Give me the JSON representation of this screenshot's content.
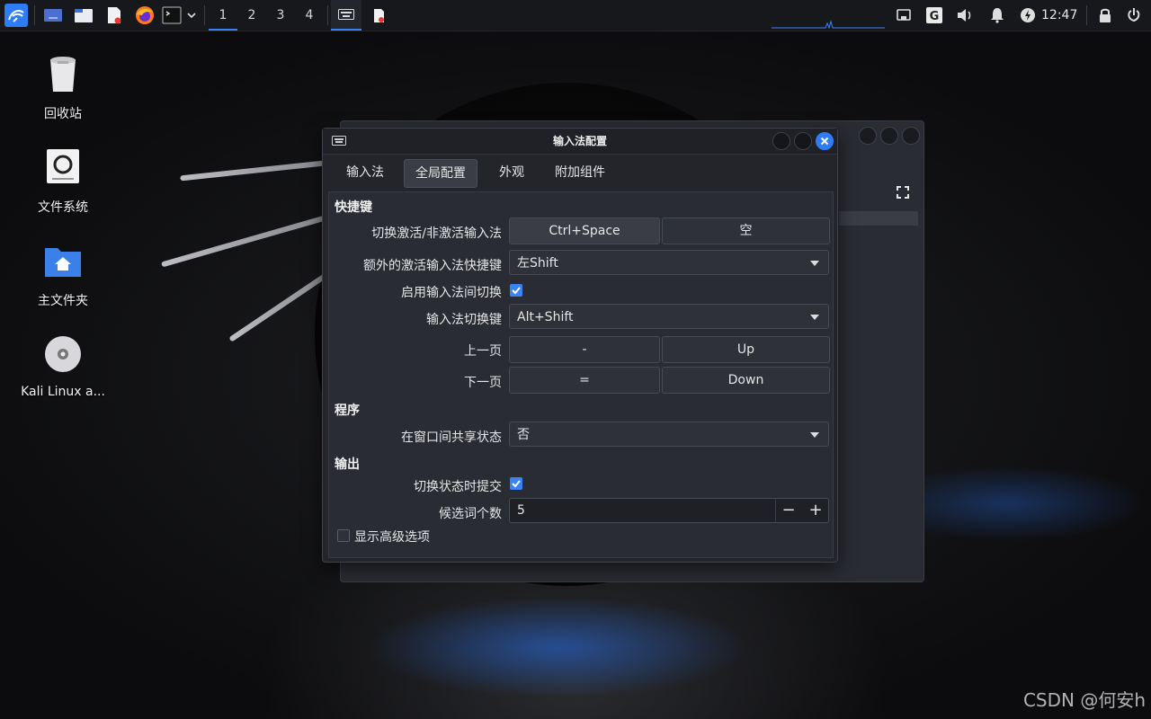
{
  "taskbar": {
    "workspaces": [
      "1",
      "2",
      "3",
      "4"
    ],
    "active_workspace": "1",
    "clock": "12:47",
    "icons": [
      "kali-menu-icon",
      "desktop-icon",
      "file-manager-icon",
      "text-editor-icon",
      "firefox-icon",
      "terminal-icon",
      "chevron-down-icon",
      "keyboard-icon",
      "document-icon",
      "network-icon",
      "google-icon",
      "volume-icon",
      "bell-icon",
      "power-icon",
      "lock-icon",
      "logout-icon"
    ]
  },
  "desktop": {
    "icons": [
      {
        "label": "回收站",
        "icon": "trash-icon"
      },
      {
        "label": "文件系统",
        "icon": "drive-icon"
      },
      {
        "label": "主文件夹",
        "icon": "home-folder-icon"
      },
      {
        "label": "Kali Linux a...",
        "icon": "disc-icon"
      }
    ]
  },
  "dialog": {
    "title": "输入法配置",
    "tabs": [
      "输入法",
      "全局配置",
      "外观",
      "附加组件"
    ],
    "active_tab": "全局配置",
    "sections": {
      "hotkeys": "快捷键",
      "program": "程序",
      "output": "输出"
    },
    "rows": {
      "toggle_im": {
        "label": "切换激活/非激活输入法",
        "key1": "Ctrl+Space",
        "key2": "空"
      },
      "extra_trigger": {
        "label": "额外的激活输入法快捷键",
        "value": "左Shift"
      },
      "enable_switch": {
        "label": "启用输入法间切换",
        "checked": true
      },
      "switch_key": {
        "label": "输入法切换键",
        "value": "Alt+Shift"
      },
      "prev_page": {
        "label": "上一页",
        "key1": "-",
        "key2": "Up"
      },
      "next_page": {
        "label": "下一页",
        "key1": "=",
        "key2": "Down"
      },
      "share_state": {
        "label": "在窗口间共享状态",
        "value": "否"
      },
      "commit_on_switch": {
        "label": "切换状态时提交",
        "checked": true
      },
      "candidate_count": {
        "label": "候选词个数",
        "value": "5",
        "minus": "−",
        "plus": "+"
      }
    },
    "advanced": {
      "label": "显示高级选项",
      "checked": false
    }
  },
  "watermark": "CSDN @何安h",
  "colors": {
    "accent": "#3b82f6",
    "panel": "#2a2c33",
    "taskbar": "#17181c"
  }
}
